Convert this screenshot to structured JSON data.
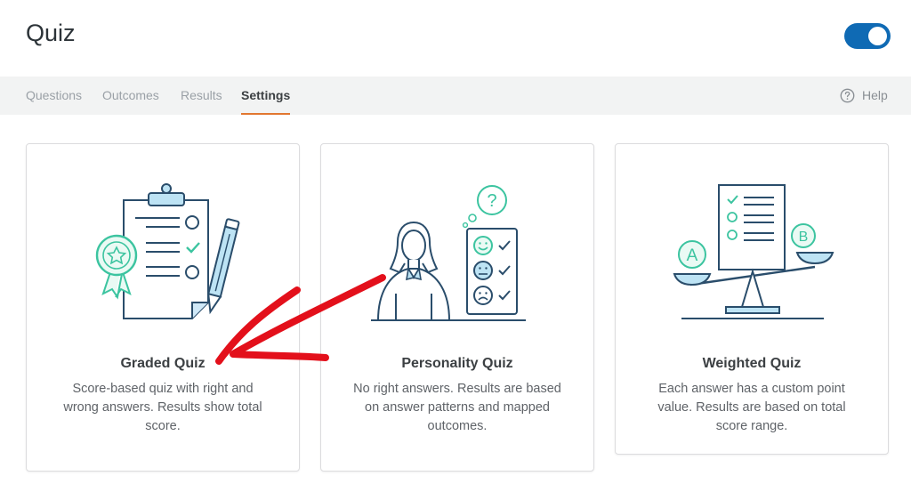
{
  "header": {
    "title": "Quiz",
    "toggle_on": true
  },
  "tabs": [
    {
      "label": "Questions",
      "active": false
    },
    {
      "label": "Outcomes",
      "active": false
    },
    {
      "label": "Results",
      "active": false
    },
    {
      "label": "Settings",
      "active": true
    }
  ],
  "help": {
    "label": "Help",
    "icon": "question-circle-icon"
  },
  "cards": [
    {
      "title": "Graded Quiz",
      "description": "Score-based quiz with right and wrong answers. Results show total score.",
      "icon": "clipboard-checklist-icon"
    },
    {
      "title": "Personality Quiz",
      "description": "No right answers. Results are based on answer patterns and mapped outcomes.",
      "icon": "person-emotions-icon"
    },
    {
      "title": "Weighted Quiz",
      "description": "Each answer has a custom point value. Results are based on total score range.",
      "icon": "balance-scale-icon"
    }
  ],
  "colors": {
    "accent": "#e27730",
    "toggle": "#0f6ab4",
    "illustration_green": "#3cc4a0",
    "illustration_blue": "#2a4d6b",
    "arrow": "#e3101b"
  }
}
